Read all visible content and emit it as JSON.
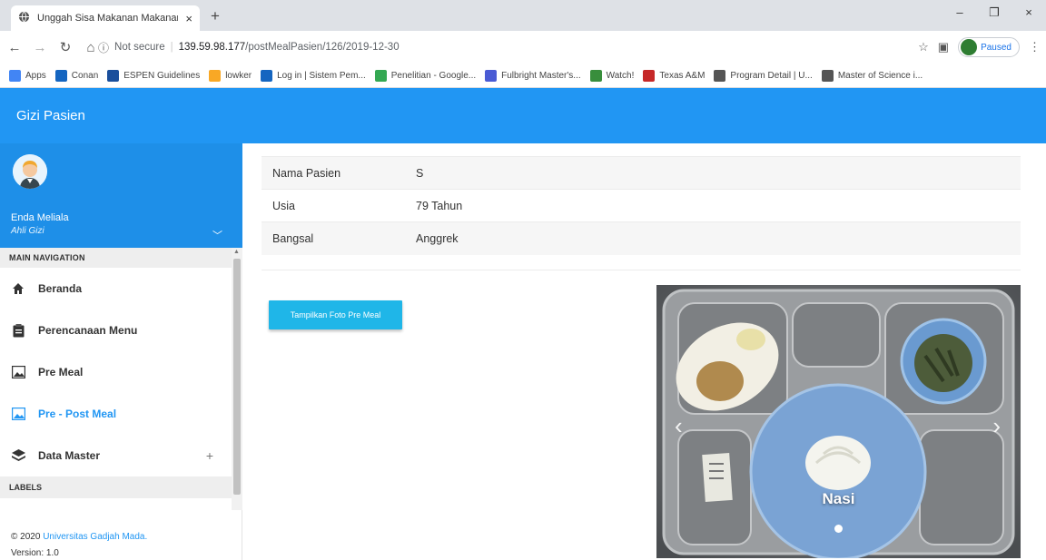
{
  "browser": {
    "tab_title": "Unggah Sisa Makanan Makanan",
    "tab_close": "×",
    "new_tab": "+",
    "win_min": "–",
    "win_max": "❐",
    "win_close": "×",
    "omnibox": {
      "security_label": "Not secure",
      "url_host": "139.59.98.177",
      "url_path": "/postMealPasien/126/2019-12-30"
    },
    "paused_label": "Paused",
    "bookmarks": [
      {
        "label": "Apps",
        "color": "#4285f4"
      },
      {
        "label": "Conan",
        "color": "#1565c0"
      },
      {
        "label": "ESPEN Guidelines",
        "color": "#1a4f9c"
      },
      {
        "label": "lowker",
        "color": "#f9a825"
      },
      {
        "label": "Log in | Sistem Pem...",
        "color": "#1565c0"
      },
      {
        "label": "Penelitian - Google...",
        "color": "#34a853"
      },
      {
        "label": "Fulbright Master's...",
        "color": "#4a5bd4"
      },
      {
        "label": "Watch!",
        "color": "#388e3c"
      },
      {
        "label": "Texas A&M",
        "color": "#c62828"
      },
      {
        "label": "Program Detail | U...",
        "color": "#555555"
      },
      {
        "label": "Master of Science i...",
        "color": "#555555"
      }
    ]
  },
  "app": {
    "title": "Gizi Pasien",
    "accent_color": "#2196f3",
    "user": {
      "name": "Enda Meliala",
      "role": "Ahli Gizi"
    },
    "nav": {
      "main_header": "MAIN NAVIGATION",
      "items": [
        {
          "label": "Beranda",
          "icon": "home-icon"
        },
        {
          "label": "Perencanaan Menu",
          "icon": "clipboard-icon"
        },
        {
          "label": "Pre Meal",
          "icon": "image-icon"
        },
        {
          "label": "Pre - Post Meal",
          "icon": "image-icon",
          "active": true
        },
        {
          "label": "Data Master",
          "icon": "layers-icon",
          "expand": "+"
        }
      ],
      "labels_header": "LABELS"
    },
    "footer": {
      "copyright_prefix": "© 2020",
      "org": "Universitas Gadjah Mada.",
      "version": "Version: 1.0"
    }
  },
  "patient": {
    "rows": [
      {
        "label": "Nama Pasien",
        "value": "S"
      },
      {
        "label": "Usia",
        "value": "79 Tahun"
      },
      {
        "label": "Bangsal",
        "value": "Anggrek"
      }
    ]
  },
  "actions": {
    "show_pre_meal": "Tampilkan Foto Pre Meal"
  },
  "carousel": {
    "caption": "Nasi",
    "prev": "‹",
    "next": "›"
  }
}
